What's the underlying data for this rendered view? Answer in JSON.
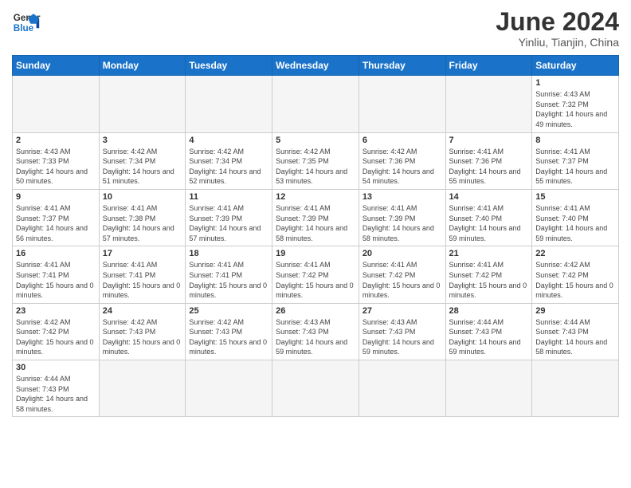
{
  "header": {
    "logo_general": "General",
    "logo_blue": "Blue",
    "title": "June 2024",
    "subtitle": "Yinliu, Tianjin, China"
  },
  "weekdays": [
    "Sunday",
    "Monday",
    "Tuesday",
    "Wednesday",
    "Thursday",
    "Friday",
    "Saturday"
  ],
  "weeks": [
    [
      {
        "day": "",
        "info": ""
      },
      {
        "day": "",
        "info": ""
      },
      {
        "day": "",
        "info": ""
      },
      {
        "day": "",
        "info": ""
      },
      {
        "day": "",
        "info": ""
      },
      {
        "day": "",
        "info": ""
      },
      {
        "day": "1",
        "info": "Sunrise: 4:43 AM\nSunset: 7:32 PM\nDaylight: 14 hours\nand 49 minutes."
      }
    ],
    [
      {
        "day": "2",
        "info": "Sunrise: 4:43 AM\nSunset: 7:33 PM\nDaylight: 14 hours\nand 50 minutes."
      },
      {
        "day": "3",
        "info": "Sunrise: 4:42 AM\nSunset: 7:34 PM\nDaylight: 14 hours\nand 51 minutes."
      },
      {
        "day": "4",
        "info": "Sunrise: 4:42 AM\nSunset: 7:34 PM\nDaylight: 14 hours\nand 52 minutes."
      },
      {
        "day": "5",
        "info": "Sunrise: 4:42 AM\nSunset: 7:35 PM\nDaylight: 14 hours\nand 53 minutes."
      },
      {
        "day": "6",
        "info": "Sunrise: 4:42 AM\nSunset: 7:36 PM\nDaylight: 14 hours\nand 54 minutes."
      },
      {
        "day": "7",
        "info": "Sunrise: 4:41 AM\nSunset: 7:36 PM\nDaylight: 14 hours\nand 55 minutes."
      },
      {
        "day": "8",
        "info": "Sunrise: 4:41 AM\nSunset: 7:37 PM\nDaylight: 14 hours\nand 55 minutes."
      }
    ],
    [
      {
        "day": "9",
        "info": "Sunrise: 4:41 AM\nSunset: 7:37 PM\nDaylight: 14 hours\nand 56 minutes."
      },
      {
        "day": "10",
        "info": "Sunrise: 4:41 AM\nSunset: 7:38 PM\nDaylight: 14 hours\nand 57 minutes."
      },
      {
        "day": "11",
        "info": "Sunrise: 4:41 AM\nSunset: 7:39 PM\nDaylight: 14 hours\nand 57 minutes."
      },
      {
        "day": "12",
        "info": "Sunrise: 4:41 AM\nSunset: 7:39 PM\nDaylight: 14 hours\nand 58 minutes."
      },
      {
        "day": "13",
        "info": "Sunrise: 4:41 AM\nSunset: 7:39 PM\nDaylight: 14 hours\nand 58 minutes."
      },
      {
        "day": "14",
        "info": "Sunrise: 4:41 AM\nSunset: 7:40 PM\nDaylight: 14 hours\nand 59 minutes."
      },
      {
        "day": "15",
        "info": "Sunrise: 4:41 AM\nSunset: 7:40 PM\nDaylight: 14 hours\nand 59 minutes."
      }
    ],
    [
      {
        "day": "16",
        "info": "Sunrise: 4:41 AM\nSunset: 7:41 PM\nDaylight: 15 hours\nand 0 minutes."
      },
      {
        "day": "17",
        "info": "Sunrise: 4:41 AM\nSunset: 7:41 PM\nDaylight: 15 hours\nand 0 minutes."
      },
      {
        "day": "18",
        "info": "Sunrise: 4:41 AM\nSunset: 7:41 PM\nDaylight: 15 hours\nand 0 minutes."
      },
      {
        "day": "19",
        "info": "Sunrise: 4:41 AM\nSunset: 7:42 PM\nDaylight: 15 hours\nand 0 minutes."
      },
      {
        "day": "20",
        "info": "Sunrise: 4:41 AM\nSunset: 7:42 PM\nDaylight: 15 hours\nand 0 minutes."
      },
      {
        "day": "21",
        "info": "Sunrise: 4:41 AM\nSunset: 7:42 PM\nDaylight: 15 hours\nand 0 minutes."
      },
      {
        "day": "22",
        "info": "Sunrise: 4:42 AM\nSunset: 7:42 PM\nDaylight: 15 hours\nand 0 minutes."
      }
    ],
    [
      {
        "day": "23",
        "info": "Sunrise: 4:42 AM\nSunset: 7:42 PM\nDaylight: 15 hours\nand 0 minutes."
      },
      {
        "day": "24",
        "info": "Sunrise: 4:42 AM\nSunset: 7:43 PM\nDaylight: 15 hours\nand 0 minutes."
      },
      {
        "day": "25",
        "info": "Sunrise: 4:42 AM\nSunset: 7:43 PM\nDaylight: 15 hours\nand 0 minutes."
      },
      {
        "day": "26",
        "info": "Sunrise: 4:43 AM\nSunset: 7:43 PM\nDaylight: 14 hours\nand 59 minutes."
      },
      {
        "day": "27",
        "info": "Sunrise: 4:43 AM\nSunset: 7:43 PM\nDaylight: 14 hours\nand 59 minutes."
      },
      {
        "day": "28",
        "info": "Sunrise: 4:44 AM\nSunset: 7:43 PM\nDaylight: 14 hours\nand 59 minutes."
      },
      {
        "day": "29",
        "info": "Sunrise: 4:44 AM\nSunset: 7:43 PM\nDaylight: 14 hours\nand 58 minutes."
      }
    ],
    [
      {
        "day": "30",
        "info": "Sunrise: 4:44 AM\nSunset: 7:43 PM\nDaylight: 14 hours\nand 58 minutes."
      },
      {
        "day": "",
        "info": ""
      },
      {
        "day": "",
        "info": ""
      },
      {
        "day": "",
        "info": ""
      },
      {
        "day": "",
        "info": ""
      },
      {
        "day": "",
        "info": ""
      },
      {
        "day": "",
        "info": ""
      }
    ]
  ]
}
